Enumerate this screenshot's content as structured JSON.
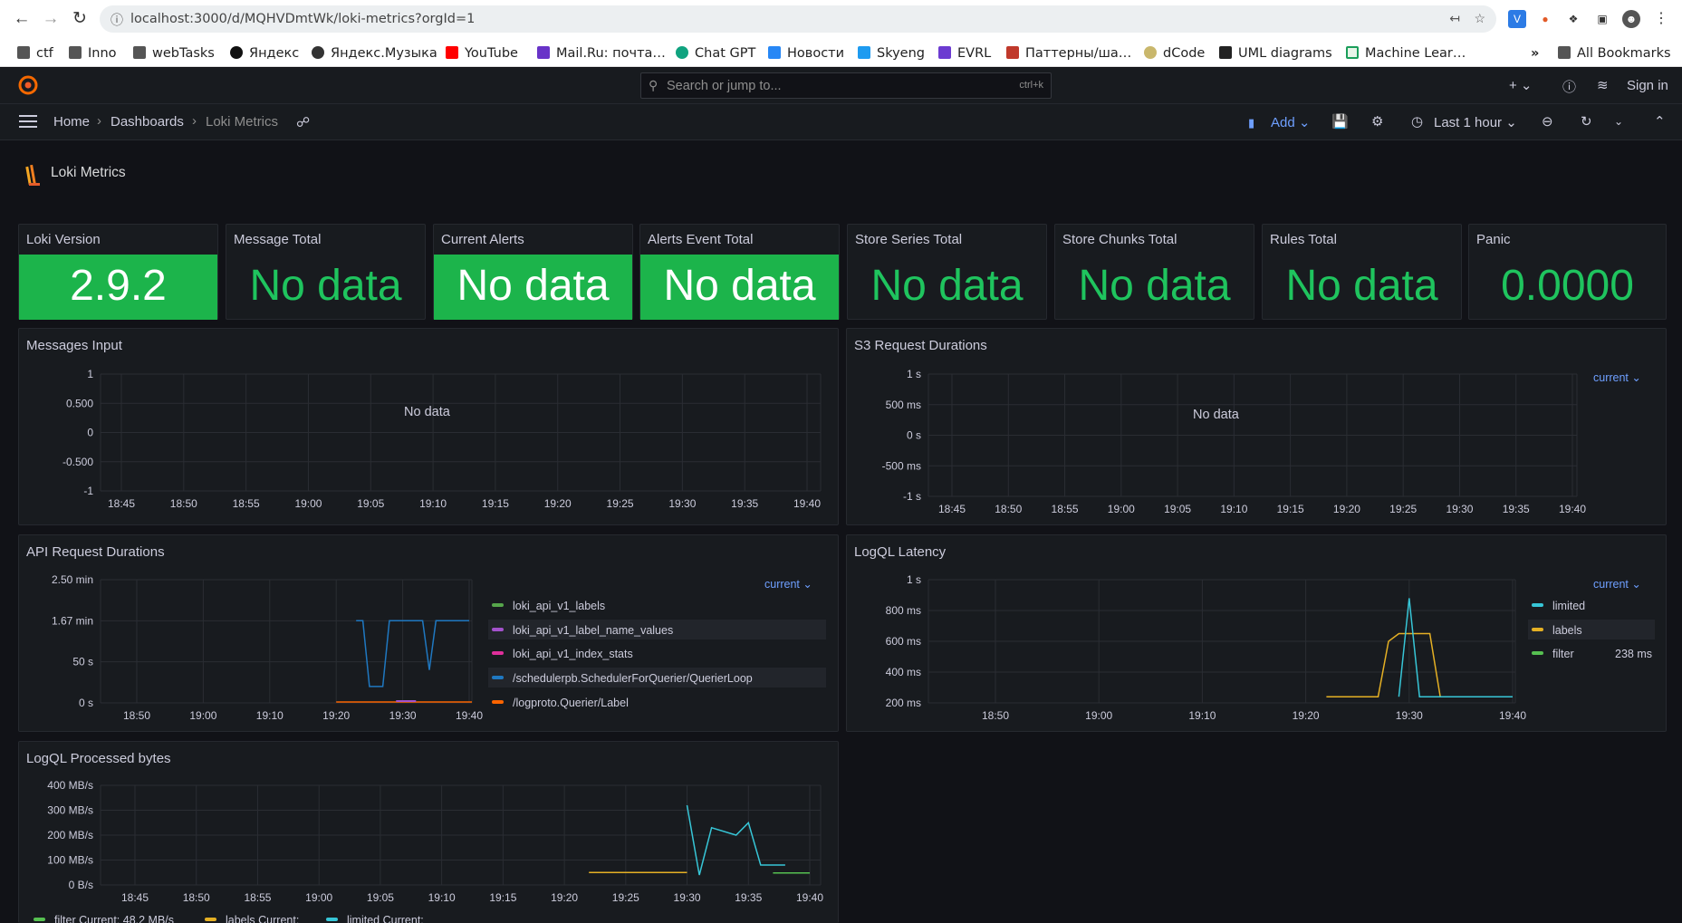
{
  "browser": {
    "url": "localhost:3000/d/MQHVDmtWk/loki-metrics?orgId=1",
    "bookmarks": [
      "ctf",
      "Inno",
      "webTasks",
      "Яндекс",
      "Яндекс.Музыка",
      "YouTube",
      "Mail.Ru: почта…",
      "Chat GPT",
      "Новости",
      "Skyeng",
      "EVRL",
      "Паттерны/ша…",
      "dCode",
      "UML diagrams",
      "Machine Lear…"
    ],
    "bookmarks_more": "»",
    "all_bookmarks": "All Bookmarks"
  },
  "grafana": {
    "search_placeholder": "Search or jump to...",
    "search_shortcut": "ctrl+k",
    "sign_in": "Sign in",
    "breadcrumb": [
      "Home",
      "Dashboards",
      "Loki Metrics"
    ],
    "add_label": "Add",
    "time_range": "Last 1 hour",
    "dashboard_title": "Loki Metrics"
  },
  "stats": [
    {
      "title": "Loki Version",
      "value": "2.9.2",
      "bg": "green"
    },
    {
      "title": "Message Total",
      "value": "No data",
      "bg": "none"
    },
    {
      "title": "Current Alerts",
      "value": "No data",
      "bg": "green"
    },
    {
      "title": "Alerts Event Total",
      "value": "No data",
      "bg": "green"
    },
    {
      "title": "Store Series Total",
      "value": "No data",
      "bg": "none"
    },
    {
      "title": "Store Chunks Total",
      "value": "No data",
      "bg": "none"
    },
    {
      "title": "Rules Total",
      "value": "No data",
      "bg": "none"
    },
    {
      "title": "Panic",
      "value": "0.0000",
      "bg": "none"
    }
  ],
  "panels": {
    "messages_input": {
      "title": "Messages Input",
      "no_data": "No data",
      "yticks": [
        "1",
        "0.500",
        "0",
        "-0.500",
        "-1"
      ],
      "xticks": [
        "18:45",
        "18:50",
        "18:55",
        "19:00",
        "19:05",
        "19:10",
        "19:15",
        "19:20",
        "19:25",
        "19:30",
        "19:35",
        "19:40"
      ]
    },
    "s3_durations": {
      "title": "S3 Request Durations",
      "no_data": "No data",
      "current": "current",
      "yticks": [
        "1 s",
        "500 ms",
        "0 s",
        "-500 ms",
        "-1 s"
      ],
      "xticks": [
        "18:45",
        "18:50",
        "18:55",
        "19:00",
        "19:05",
        "19:10",
        "19:15",
        "19:20",
        "19:25",
        "19:30",
        "19:35",
        "19:40"
      ]
    },
    "api_durations": {
      "title": "API Request Durations",
      "current": "current",
      "yticks": [
        "2.50 min",
        "1.67 min",
        "50 s",
        "0 s"
      ],
      "xticks": [
        "18:50",
        "19:00",
        "19:10",
        "19:20",
        "19:30",
        "19:40"
      ],
      "legend": [
        {
          "name": "loki_api_v1_labels",
          "color": "#56a64b"
        },
        {
          "name": "loki_api_v1_label_name_values",
          "color": "#a352cc"
        },
        {
          "name": "loki_api_v1_index_stats",
          "color": "#e02f9b"
        },
        {
          "name": "/schedulerpb.SchedulerForQuerier/QuerierLoop",
          "color": "#1f78c1"
        },
        {
          "name": "/logproto.Querier/Label",
          "color": "#fa6400"
        }
      ]
    },
    "logql_latency": {
      "title": "LogQL Latency",
      "current": "current",
      "yticks": [
        "1 s",
        "800 ms",
        "600 ms",
        "400 ms",
        "200 ms"
      ],
      "xticks": [
        "18:50",
        "19:00",
        "19:10",
        "19:20",
        "19:30",
        "19:40"
      ],
      "legend": [
        {
          "name": "limited",
          "color": "#37c6d7",
          "value": ""
        },
        {
          "name": "labels",
          "color": "#e5b024",
          "value": ""
        },
        {
          "name": "filter",
          "color": "#56c051",
          "value": "238 ms"
        }
      ]
    },
    "logql_bytes": {
      "title": "LogQL Processed bytes",
      "yticks": [
        "400 MB/s",
        "300 MB/s",
        "200 MB/s",
        "100 MB/s",
        "0 B/s"
      ],
      "xticks": [
        "18:45",
        "18:50",
        "18:55",
        "19:00",
        "19:05",
        "19:10",
        "19:15",
        "19:20",
        "19:25",
        "19:30",
        "19:35",
        "19:40"
      ],
      "legend": [
        {
          "name": "filter",
          "color": "#56c051",
          "value": "Current: 48.2 MB/s"
        },
        {
          "name": "labels",
          "color": "#e5b024",
          "value": "Current:"
        },
        {
          "name": "limited",
          "color": "#37c6d7",
          "value": "Current:"
        }
      ]
    }
  },
  "chart_data": [
    {
      "type": "line",
      "title": "API Request Durations",
      "x": [
        "19:23",
        "19:24",
        "19:25",
        "19:27",
        "19:28",
        "19:29",
        "19:33",
        "19:34",
        "19:35",
        "19:40"
      ],
      "series": [
        {
          "name": "/schedulerpb.SchedulerForQuerier/QuerierLoop",
          "values": [
            100,
            100,
            20,
            20,
            100,
            100,
            100,
            40,
            100,
            100
          ]
        }
      ],
      "ylim": [
        0,
        150
      ]
    },
    {
      "type": "line",
      "title": "LogQL Latency",
      "series": [
        {
          "name": "labels",
          "x": [
            "19:22",
            "19:27",
            "19:28",
            "19:29",
            "19:30",
            "19:32",
            "19:33",
            "19:40"
          ],
          "values": [
            240,
            240,
            600,
            650,
            650,
            650,
            240,
            240
          ]
        },
        {
          "name": "limited",
          "x": [
            "19:29",
            "19:30",
            "19:31",
            "19:40"
          ],
          "values": [
            240,
            880,
            240,
            240
          ]
        }
      ],
      "ylim": [
        200,
        1000
      ]
    },
    {
      "type": "line",
      "title": "LogQL Processed bytes",
      "series": [
        {
          "name": "labels",
          "x": [
            "19:22",
            "19:30"
          ],
          "values": [
            50,
            50
          ]
        },
        {
          "name": "limited",
          "x": [
            "19:30",
            "19:31",
            "19:32",
            "19:34",
            "19:35",
            "19:36",
            "19:38"
          ],
          "values": [
            320,
            40,
            230,
            200,
            250,
            80,
            80
          ]
        },
        {
          "name": "filter",
          "x": [
            "19:37",
            "19:40"
          ],
          "values": [
            48.2,
            48.2
          ]
        }
      ],
      "ylim": [
        0,
        400
      ]
    }
  ]
}
